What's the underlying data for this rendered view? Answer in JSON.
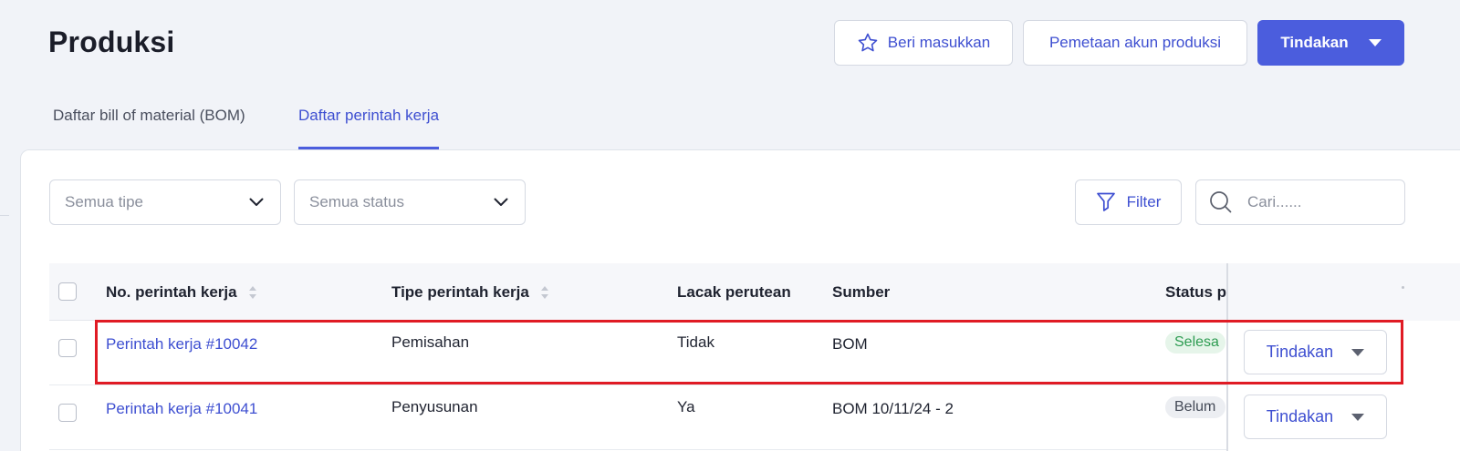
{
  "header": {
    "title": "Produksi",
    "feedback_label": "Beri masukkan",
    "mapping_label": "Pemetaan akun produksi",
    "actions_label": "Tindakan"
  },
  "tabs": [
    {
      "label": "Daftar bill of material (BOM)",
      "active": false
    },
    {
      "label": "Daftar perintah kerja",
      "active": true
    }
  ],
  "filters": {
    "type_placeholder": "Semua tipe",
    "status_placeholder": "Semua status",
    "filter_label": "Filter",
    "search_placeholder": "Cari......"
  },
  "table": {
    "columns": [
      "No. perintah kerja",
      "Tipe perintah kerja",
      "Lacak perutean",
      "Sumber",
      "Status p"
    ],
    "rows": [
      {
        "number": "Perintah kerja #10042",
        "type": "Pemisahan",
        "routing": "Tidak",
        "source": "BOM",
        "status": "Selesa",
        "action": "Tindakan"
      },
      {
        "number": "Perintah kerja #10041",
        "type": "Penyusunan",
        "routing": "Ya",
        "source": "BOM 10/11/24 - 2",
        "status": "Belum",
        "action": "Tindakan"
      }
    ]
  },
  "colors": {
    "accent": "#4b5ddd",
    "link": "#3e4fd1",
    "success": "#2e9c52",
    "highlight": "#e01b24"
  },
  "icons": [
    "star-icon",
    "chevron-down-icon",
    "filter-icon",
    "search-icon",
    "sort-icon",
    "caret-down-icon"
  ]
}
